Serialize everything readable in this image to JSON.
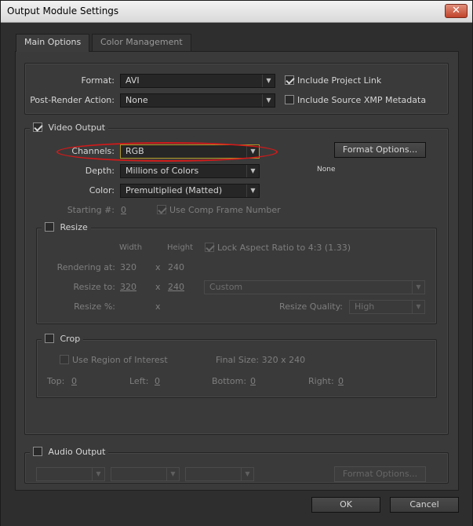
{
  "window": {
    "title": "Output Module Settings",
    "close_glyph": "✕"
  },
  "tabs": [
    {
      "label": "Main Options",
      "active": true
    },
    {
      "label": "Color Management",
      "active": false
    }
  ],
  "format": {
    "format_label": "Format:",
    "format_value": "AVI",
    "post_render_label": "Post-Render Action:",
    "post_render_value": "None",
    "include_project_link": "Include Project Link",
    "include_xmp": "Include Source XMP Metadata"
  },
  "video": {
    "legend": "Video Output",
    "channels_label": "Channels:",
    "channels_value": "RGB",
    "depth_label": "Depth:",
    "depth_value": "Millions of Colors",
    "color_label": "Color:",
    "color_value": "Premultiplied (Matted)",
    "starting_label": "Starting #:",
    "starting_value": "0",
    "use_comp_frame": "Use Comp Frame Number",
    "format_options": "Format Options...",
    "codec_info": "None"
  },
  "resize": {
    "legend": "Resize",
    "width_hdr": "Width",
    "height_hdr": "Height",
    "lock_aspect": "Lock Aspect Ratio to 4:3 (1.33)",
    "rendering_at_label": "Rendering at:",
    "rendering_w": "320",
    "rendering_h": "240",
    "resize_to_label": "Resize to:",
    "resize_to_w": "320",
    "resize_to_h": "240",
    "resize_preset": "Custom",
    "resize_pct_label": "Resize %:",
    "x": "x",
    "quality_label": "Resize Quality:",
    "quality_value": "High"
  },
  "crop": {
    "legend": "Crop",
    "use_roi": "Use Region of Interest",
    "final_size": "Final Size: 320 x 240",
    "top_label": "Top:",
    "top_value": "0",
    "left_label": "Left:",
    "left_value": "0",
    "bottom_label": "Bottom:",
    "bottom_value": "0",
    "right_label": "Right:",
    "right_value": "0"
  },
  "audio": {
    "legend": "Audio Output",
    "format_options": "Format Options..."
  },
  "footer": {
    "ok": "OK",
    "cancel": "Cancel"
  },
  "icons": {
    "arrow": "▼"
  },
  "colors": {
    "highlight_ellipse": "#d11a1a"
  }
}
